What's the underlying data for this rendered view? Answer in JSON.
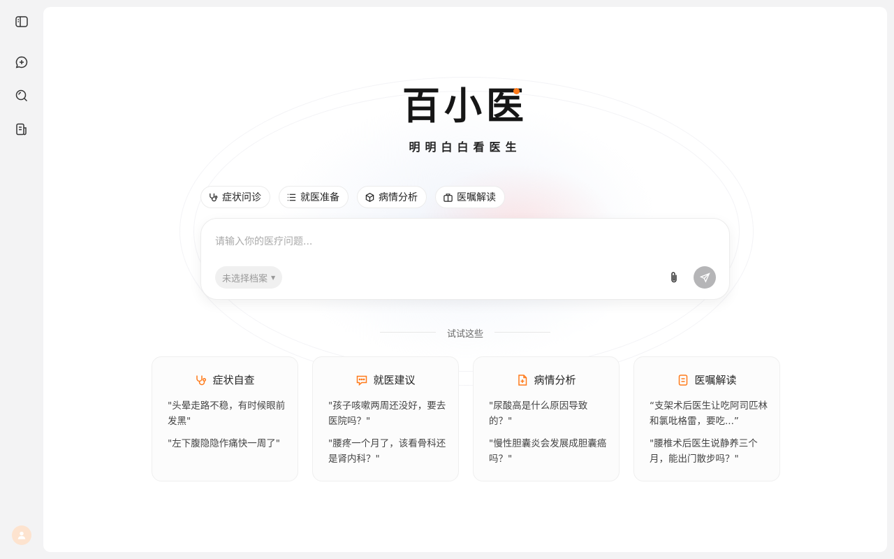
{
  "sidebar": {
    "items": [
      {
        "icon": "sidebar-toggle-icon"
      },
      {
        "icon": "new-chat-icon"
      },
      {
        "icon": "search-icon"
      },
      {
        "icon": "records-icon"
      }
    ],
    "avatar_icon": "user-icon"
  },
  "brand": {
    "logo": "百小医",
    "slogan": "明明白白看医生",
    "accent_color": "#ff7a1a"
  },
  "chips": [
    {
      "label": "症状问诊",
      "icon": "stethoscope-icon"
    },
    {
      "label": "就医准备",
      "icon": "checklist-icon"
    },
    {
      "label": "病情分析",
      "icon": "cube-icon"
    },
    {
      "label": "医嘱解读",
      "icon": "medkit-icon"
    }
  ],
  "input": {
    "placeholder": "请输入你的医疗问题...",
    "profile_select": "未选择档案"
  },
  "suggestions_title": "试试这些",
  "cards": [
    {
      "title": "症状自查",
      "icon": "stethoscope-icon",
      "questions": [
        "\"头晕走路不稳，有时候眼前发黑\"",
        "\"左下腹隐隐作痛快一周了\""
      ]
    },
    {
      "title": "就医建议",
      "icon": "chat-bubble-icon",
      "questions": [
        "\"孩子咳嗽两周还没好，要去医院吗？\"",
        "\"腰疼一个月了，该看骨科还是肾内科？\""
      ]
    },
    {
      "title": "病情分析",
      "icon": "medical-doc-icon",
      "questions": [
        "\"尿酸高是什么原因导致的？\"",
        "\"慢性胆囊炎会发展成胆囊癌吗？\""
      ]
    },
    {
      "title": "医嘱解读",
      "icon": "doc-lines-icon",
      "questions": [
        "“支架术后医生让吃阿司匹林和氯吡格雷，要吃...”",
        "\"腰椎术后医生说静养三个月，能出门散步吗？\""
      ]
    }
  ]
}
